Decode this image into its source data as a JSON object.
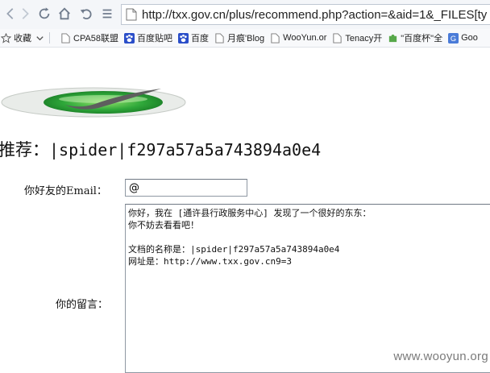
{
  "browser": {
    "address": "http://txx.gov.cn/plus/recommend.php?action=&aid=1&_FILES[ty"
  },
  "bookmarks": {
    "favorites_label": "收藏",
    "items": [
      {
        "label": "CPA58联盟",
        "icon": "page-icon"
      },
      {
        "label": "百度贴吧",
        "icon": "baidu-paw-icon"
      },
      {
        "label": "百度",
        "icon": "baidu-paw-icon"
      },
      {
        "label": "月痕'Blog",
        "icon": "page-icon"
      },
      {
        "label": "WooYun.or",
        "icon": "page-icon"
      },
      {
        "label": "Tenacy开",
        "icon": "page-icon"
      },
      {
        "label": "\"百度杯\"全",
        "icon": "puzzle-icon"
      },
      {
        "label": "Goo",
        "icon": "google-icon"
      }
    ]
  },
  "page": {
    "title_prefix": "推荐：",
    "title_doc": "|spider|f297a57a5a743894a0e4",
    "email_label": "你好友的Email：",
    "email_value": "@",
    "message_label": "你的留言：",
    "message_lines": [
      "你好，我在 [通许县行政服务中心] 发现了一个很好的东东：",
      "你不妨去看看吧！",
      "",
      "文档的名称是：|spider|f297a57a5a743894a0e4",
      "网址是：http://www.txx.gov.cn9=3"
    ]
  },
  "watermark": "www.wooyun.org",
  "colors": {
    "logo_green": "#2fa83a",
    "logo_gray": "#8e8e8e",
    "baidu_blue": "#2a4ec9",
    "google_blue": "#4a7bd8"
  }
}
